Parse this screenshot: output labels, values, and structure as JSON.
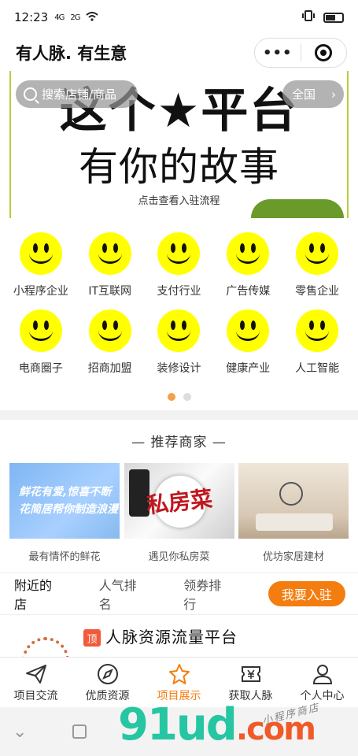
{
  "status": {
    "time": "12:23",
    "signal1": "4G",
    "signal2": "2G"
  },
  "nav": {
    "title": "有人脉. 有生意"
  },
  "banner": {
    "line1": "这个★平台",
    "line2": "有你的故事",
    "note": "点击查看入驻流程",
    "search_placeholder": "搜索店铺/商品",
    "region": "全国"
  },
  "categories": [
    {
      "label": "小程序企业"
    },
    {
      "label": "IT互联网"
    },
    {
      "label": "支付行业"
    },
    {
      "label": "广告传媒"
    },
    {
      "label": "零售企业"
    },
    {
      "label": "电商圈子"
    },
    {
      "label": "招商加盟"
    },
    {
      "label": "装修设计"
    },
    {
      "label": "健康产业"
    },
    {
      "label": "人工智能"
    }
  ],
  "recommend": {
    "title": "— 推荐商家 —",
    "items": [
      {
        "label": "最有情怀的鲜花",
        "img_text": "鲜花有爱,惊喜不断 花简居帮你制造浪漫"
      },
      {
        "label": "遇见你私房菜",
        "img_text": "私房菜"
      },
      {
        "label": "优坊家居建材",
        "img_text": ""
      }
    ]
  },
  "tabs": {
    "nearby": "附近的店",
    "popular": "人气排名",
    "coupon": "领券排行",
    "join": "我要入驻"
  },
  "shop": {
    "badge": "顶",
    "name": "人脉资源流量平台"
  },
  "tabbar": [
    {
      "label": "项目交流",
      "icon": "paper-plane-icon"
    },
    {
      "label": "优质资源",
      "icon": "compass-icon"
    },
    {
      "label": "项目展示",
      "icon": "star-icon",
      "active": true
    },
    {
      "label": "获取人脉",
      "icon": "yuan-ticket-icon"
    },
    {
      "label": "个人中心",
      "icon": "person-icon"
    }
  ],
  "watermark": {
    "main": "91ud",
    "suffix": ".com",
    "sub": "小程序商店"
  },
  "colors": {
    "accent": "#f47d10",
    "smiley": "#ffff00",
    "badge": "#f15a3a"
  }
}
